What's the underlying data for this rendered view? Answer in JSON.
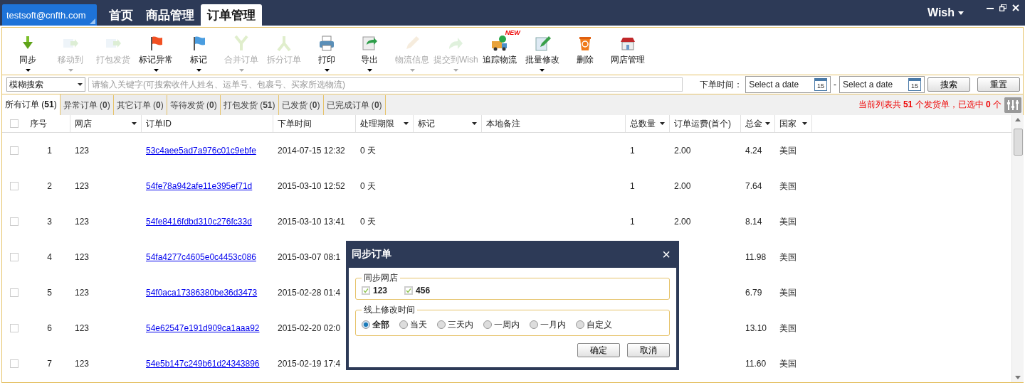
{
  "top_bar": {
    "account": "testsoft@cnfth.com",
    "tabs": [
      {
        "label": "首页",
        "selected": false
      },
      {
        "label": "商品管理",
        "selected": false
      },
      {
        "label": "订单管理",
        "selected": true
      }
    ],
    "platform": "Wish"
  },
  "toolbar": [
    {
      "kind": "sync",
      "label": "同步",
      "disabled": false,
      "has_menu": true
    },
    {
      "kind": "move",
      "label": "移动到",
      "disabled": true,
      "has_menu": true
    },
    {
      "kind": "pack",
      "label": "打包发货",
      "disabled": true,
      "has_menu": false
    },
    {
      "kind": "flag",
      "label": "标记异常",
      "disabled": false,
      "has_menu": true
    },
    {
      "kind": "mark",
      "label": "标记",
      "disabled": false,
      "has_menu": true
    },
    {
      "kind": "merge",
      "label": "合并订单",
      "disabled": true,
      "has_menu": true
    },
    {
      "kind": "split",
      "label": "拆分订单",
      "disabled": true,
      "has_menu": false
    },
    {
      "kind": "print",
      "label": "打印",
      "disabled": false,
      "has_menu": true
    },
    {
      "kind": "export",
      "label": "导出",
      "disabled": false,
      "has_menu": true
    },
    {
      "kind": "logistics",
      "label": "物流信息",
      "disabled": true,
      "has_menu": true
    },
    {
      "kind": "submit",
      "label": "提交到Wish",
      "disabled": true,
      "has_menu": true
    },
    {
      "kind": "track",
      "label": "追踪物流",
      "disabled": false,
      "has_menu": false,
      "badge": "NEW"
    },
    {
      "kind": "batch",
      "label": "批量修改",
      "disabled": false,
      "has_menu": true
    },
    {
      "kind": "delete",
      "label": "删除",
      "disabled": false,
      "has_menu": false
    },
    {
      "kind": "store",
      "label": "网店管理",
      "disabled": false,
      "has_menu": false
    }
  ],
  "search": {
    "mode": "模糊搜索",
    "placeholder": "请输入关键字(可搜索收件人姓名、运单号、包裹号、买家所选物流)",
    "date_label": "下单时间：",
    "date_from": {
      "placeholder": "Select a date",
      "calendar_day": "15"
    },
    "separator": "-",
    "date_to": {
      "placeholder": "Select a date",
      "calendar_day": "15"
    },
    "buttons": [
      "搜索",
      "重置"
    ]
  },
  "order_tabs": [
    {
      "label": "所有订单 (**51**)",
      "selected": true
    },
    {
      "label": "异常订单 (**0**)",
      "selected": false
    },
    {
      "label": "其它订单 (**0**)",
      "selected": false
    },
    {
      "label": "等待发货 (**0**)",
      "selected": false
    },
    {
      "label": "打包发货 (**51**)",
      "selected": false
    },
    {
      "label": "已发货 (**0**)",
      "selected": false
    },
    {
      "label": "已完成订单 (**0**)",
      "selected": false
    }
  ],
  "list_summary": "当前列表共 **51** 个发货单，已选中 **0** 个",
  "table": {
    "select_all_checked": false,
    "columns": [
      {
        "label": "序号",
        "has_filter": false
      },
      {
        "label": "网店",
        "has_filter": true
      },
      {
        "label": "订单ID",
        "has_filter": false
      },
      {
        "label": "下单时间",
        "has_filter": false
      },
      {
        "label": "处理期限",
        "has_filter": true
      },
      {
        "label": "标记",
        "has_filter": true
      },
      {
        "label": "本地备注",
        "has_filter": false
      },
      {
        "label": "总数量",
        "has_filter": true
      },
      {
        "label": "订单运费(首个)",
        "has_filter": false
      },
      {
        "label": "总金",
        "has_filter": true
      },
      {
        "label": "国家",
        "has_filter": true
      }
    ],
    "rows": [
      {
        "checked": false,
        "cells": [
          "1",
          "123",
          "53c4aee5ad7a976c01c9ebfe",
          "2014-07-15 12:32",
          "0 天",
          "",
          "",
          "1",
          "2.00",
          "4.24",
          "美国"
        ]
      },
      {
        "checked": false,
        "cells": [
          "2",
          "123",
          "54fe78a942afe11e395ef71d",
          "2015-03-10 12:52",
          "0 天",
          "",
          "",
          "1",
          "2.00",
          "7.64",
          "美国"
        ]
      },
      {
        "checked": false,
        "cells": [
          "3",
          "123",
          "54fe8416fdbd310c276fc33d",
          "2015-03-10 13:41",
          "0 天",
          "",
          "",
          "1",
          "2.00",
          "8.14",
          "美国"
        ]
      },
      {
        "checked": false,
        "cells": [
          "4",
          "123",
          "54fa4277c4605e0c4453c086",
          "2015-03-07 08:1",
          "",
          "",
          "",
          "",
          "",
          "11.98",
          "美国"
        ]
      },
      {
        "checked": false,
        "cells": [
          "5",
          "123",
          "54f0aca17386380be36d3473",
          "2015-02-28 01:4",
          "",
          "",
          "",
          "",
          "",
          "6.79",
          "美国"
        ]
      },
      {
        "checked": false,
        "cells": [
          "6",
          "123",
          "54e62547e191d909ca1aaa92",
          "2015-02-20 02:0",
          "",
          "",
          "",
          "",
          "",
          "13.10",
          "美国"
        ]
      },
      {
        "checked": false,
        "cells": [
          "7",
          "123",
          "54e5b147c249b61d24343896",
          "2015-02-19 17:4",
          "",
          "",
          "",
          "",
          "",
          "11.60",
          "美国"
        ]
      }
    ]
  },
  "dialog": {
    "title": "同步订单",
    "close": "×",
    "shops_legend": "同步网店",
    "shops": [
      {
        "label": "123",
        "checked": true
      },
      {
        "label": "456",
        "checked": true
      }
    ],
    "time_legend": "线上修改时间",
    "time_options": [
      {
        "label": "全部",
        "selected": true
      },
      {
        "label": "当天",
        "selected": false
      },
      {
        "label": "三天内",
        "selected": false
      },
      {
        "label": "一周内",
        "selected": false
      },
      {
        "label": "一月内",
        "selected": false
      },
      {
        "label": "自定义",
        "selected": false
      }
    ],
    "buttons": [
      "确定",
      "取消"
    ]
  }
}
